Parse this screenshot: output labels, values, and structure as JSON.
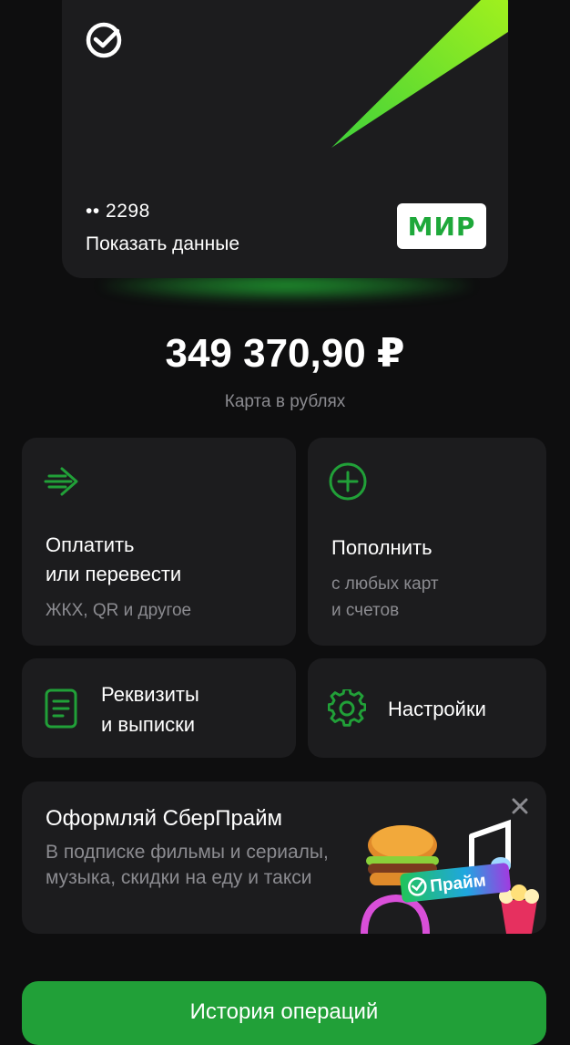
{
  "card": {
    "number_masked": "•• 2298",
    "show_details_label": "Показать данные",
    "payment_system": "МИР"
  },
  "balance": {
    "amount": "349 370,90 ₽",
    "caption": "Карта в рублях"
  },
  "actions": {
    "pay": {
      "title_line1": "Оплатить",
      "title_line2": "или перевести",
      "subtitle": "ЖКХ, QR и другое",
      "icon": "transfer-arrow-icon"
    },
    "topup": {
      "title": "Пополнить",
      "subtitle_line1": "с любых карт",
      "subtitle_line2": "и счетов",
      "icon": "plus-circle-icon"
    },
    "requisites": {
      "title_line1": "Реквизиты",
      "title_line2": "и выписки",
      "icon": "document-icon"
    },
    "settings": {
      "title": "Настройки",
      "icon": "gear-icon"
    }
  },
  "promo": {
    "title": "Оформляй СберПрайм",
    "text": "В подписке фильмы и сериалы, музыка, скидки на еду и такси",
    "badge": "Прайм"
  },
  "history_button": {
    "label": "История операций"
  },
  "colors": {
    "background": "#0e0e0f",
    "tile": "#1c1c1e",
    "accent_green": "#21a038",
    "muted_text": "#8b8b90"
  }
}
